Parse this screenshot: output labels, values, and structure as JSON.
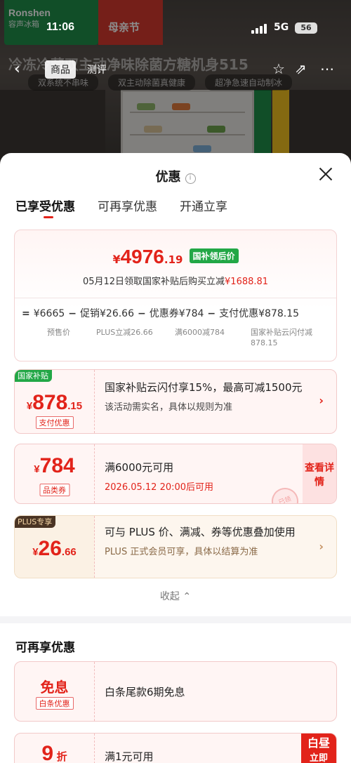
{
  "status_bar": {
    "time": "11:06",
    "network": "5G",
    "battery": "56"
  },
  "background": {
    "brand": "Ronshen",
    "brand_cn": "容声冰箱",
    "festival": "母亲节",
    "title": "冷冻冷藏双主动净味除菌方糖机身515",
    "tags": [
      "双系统不串味",
      "双主动除菌真健康",
      "超净急速自动制冰"
    ],
    "nav": {
      "product": "商品",
      "review": "测评"
    }
  },
  "sheet": {
    "title": "优惠",
    "info_icon": "i",
    "tabs": [
      "已享受优惠",
      "可再享优惠",
      "开通立享"
    ],
    "summary": {
      "currency": "¥",
      "price_int": "4976",
      "price_dec": ".19",
      "badge": "国补领后价",
      "desc_prefix": "05月12日领取国家补贴后购买立减",
      "desc_amount": "¥1688.81",
      "calc": {
        "eq": "=",
        "presale": "¥6665",
        "minus": "−",
        "promo": "促销¥26.66",
        "coupon": "优惠券¥784",
        "pay": "支付优惠¥878.15",
        "presale_sub": "预售价",
        "promo_sub": "PLUS立减26.66",
        "coupon_sub": "满6000减784",
        "pay_sub": "国家补贴云闪付减878.15"
      }
    },
    "coupons": [
      {
        "corner": "国家补贴",
        "currency": "¥",
        "int": "878",
        "dec": ".15",
        "tag": "支付优惠",
        "main": "国家补贴云闪付享15%，最高可减1500元",
        "sub": "该活动需实名，具体以规则为准",
        "chev": "›"
      },
      {
        "currency": "¥",
        "int": "784",
        "tag": "品类券",
        "main": "满6000元可用",
        "sub": "2026.05.12 20:00后可用",
        "cta": "查看详情",
        "seal": "已领"
      },
      {
        "corner": "PLUS专享",
        "currency": "¥",
        "int": "26",
        "dec": ".66",
        "main": "可与 PLUS 价、满减、券等优惠叠加使用",
        "sub": "PLUS 正式会员可享，具体以结算为准",
        "chev": "›"
      }
    ],
    "collapse": "收起",
    "more_title": "可再享优惠",
    "more": [
      {
        "amount": "免息",
        "tag": "白条优惠",
        "main": "白条尾款6期免息"
      },
      {
        "amount": "9",
        "unit": "折",
        "main": "满1元可用",
        "hot_1": "白昼",
        "hot_2": "立即"
      }
    ]
  },
  "colors": {
    "accent": "#e2231a",
    "green": "#22a746",
    "plus_dark": "#4a3424"
  }
}
